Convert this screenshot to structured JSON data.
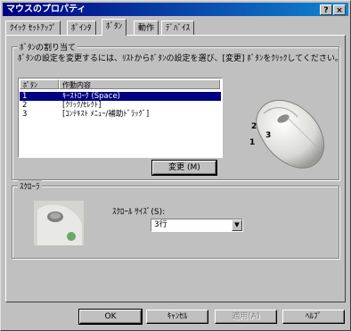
{
  "window": {
    "title": "マウスのプロパティ",
    "help_glyph": "?",
    "close_glyph": "×"
  },
  "tabs": [
    {
      "label": "ｸｲｯｸ ｾｯﾄｱｯﾌﾟ"
    },
    {
      "label": "ﾎﾟｲﾝﾀ"
    },
    {
      "label": "ﾎﾞﾀﾝ",
      "active": true
    },
    {
      "label": "動作"
    },
    {
      "label": "ﾃﾞﾊﾞｲｽ"
    }
  ],
  "buttons_group": {
    "title": "ﾎﾞﾀﾝの割り当て",
    "description": "ﾎﾞﾀﾝの設定を変更するには、ﾘｽﾄからﾎﾞﾀﾝの設定を選び、[変更] ﾎﾞﾀﾝをｸﾘｯｸしてください。",
    "columns": [
      "ﾎﾞﾀﾝ",
      "作動内容"
    ],
    "rows": [
      {
        "button": "1",
        "action": "ｷｰｽﾄﾛｰｸ (Space)",
        "selected": true
      },
      {
        "button": "2",
        "action": "[ｸﾘｯｸ/ｾﾚｸﾄ]",
        "selected": false
      },
      {
        "button": "3",
        "action": "[ｺﾝﾃｷｽﾄ ﾒﾆｭｰ/補助ﾄﾞﾗｯｸﾞ]",
        "selected": false
      }
    ],
    "change_button": "変更 (M)",
    "mouse_labels": [
      "2",
      "3",
      "1"
    ]
  },
  "scroller_group": {
    "title": "ｽｸﾛｰﾗ",
    "scroll_size_label": "ｽｸﾛｰﾙ ｻｲｽﾞ(S):",
    "scroll_size_value": "3行"
  },
  "footer": {
    "ok": "OK",
    "cancel": "ｷｬﾝｾﾙ",
    "apply": "適用(A)",
    "help": "ﾍﾙﾌﾟ"
  },
  "colors": {
    "title_bar": "#000080",
    "selection": "#000080",
    "face": "#c0c0c0"
  }
}
